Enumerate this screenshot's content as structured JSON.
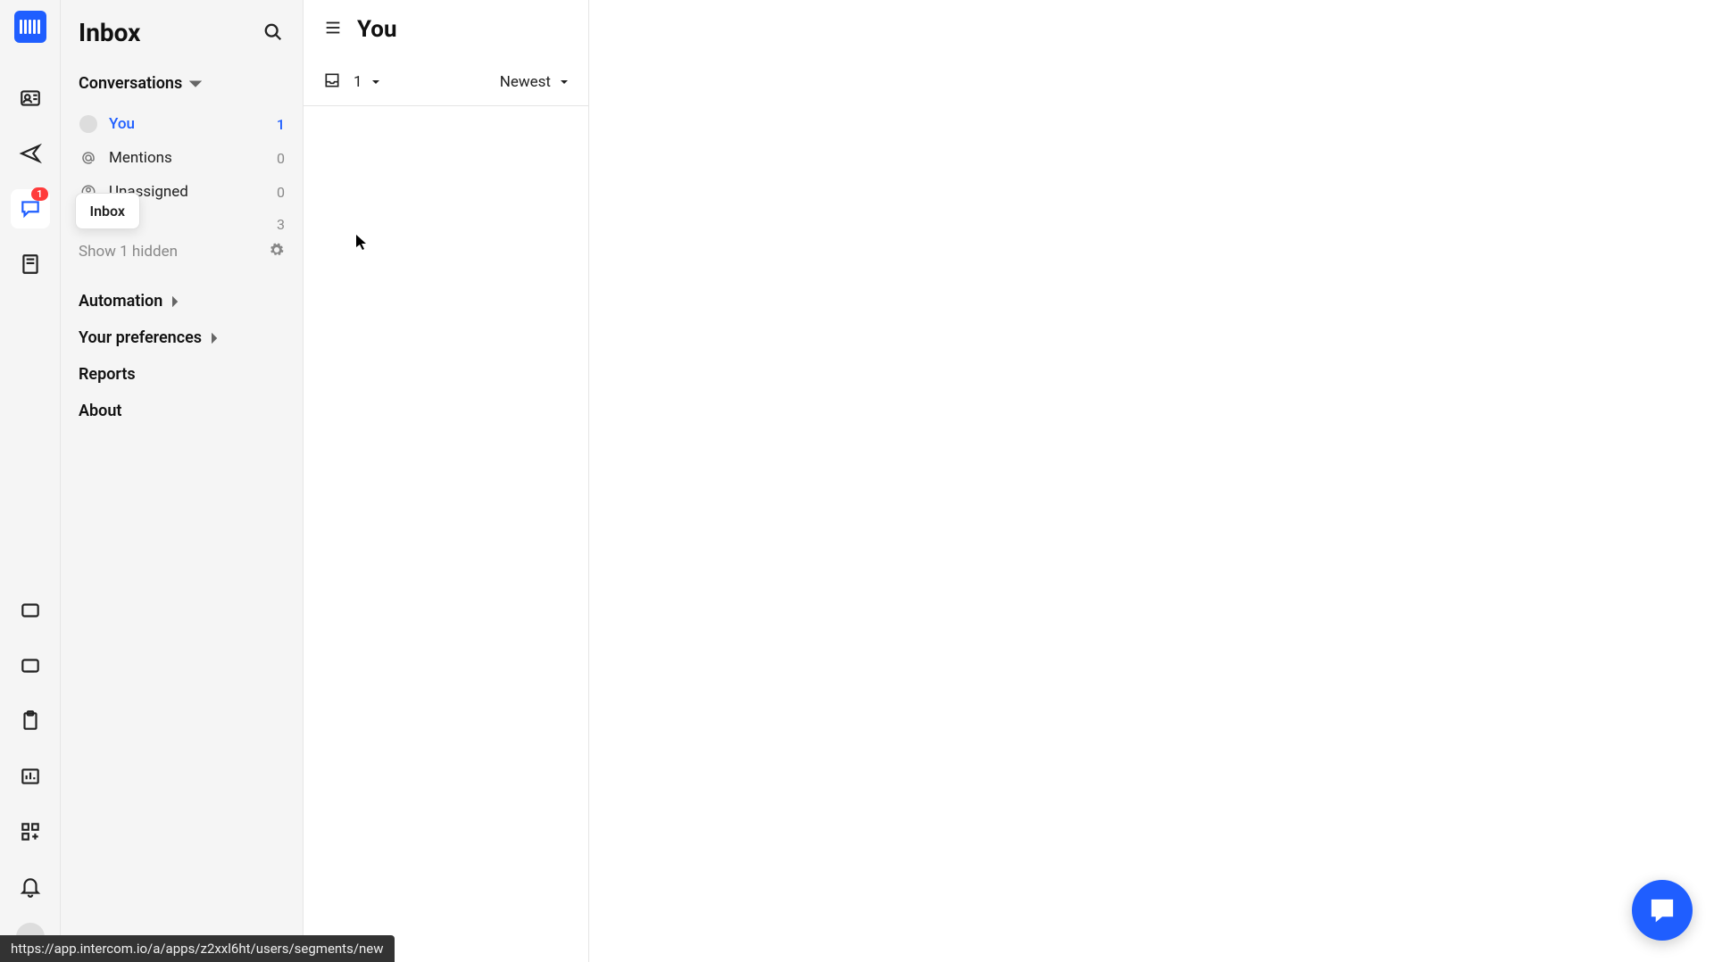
{
  "rail": {
    "inbox_badge": "1",
    "tooltip_inbox": "Inbox"
  },
  "sidebar": {
    "title": "Inbox",
    "conversations_label": "Conversations",
    "items": {
      "you": {
        "label": "You",
        "count": "1"
      },
      "mentions": {
        "label": "Mentions",
        "count": "0"
      },
      "unassigned": {
        "label": "Unassigned",
        "count": "0"
      },
      "all": {
        "label": "",
        "count": "3"
      }
    },
    "show_hidden": "Show 1 hidden",
    "automation": "Automation",
    "preferences": "Your preferences",
    "reports": "Reports",
    "about": "About"
  },
  "main": {
    "title": "You",
    "count": "1",
    "sort": "Newest"
  },
  "status_url": "https://app.intercom.io/a/apps/z2xxl6ht/users/segments/new"
}
